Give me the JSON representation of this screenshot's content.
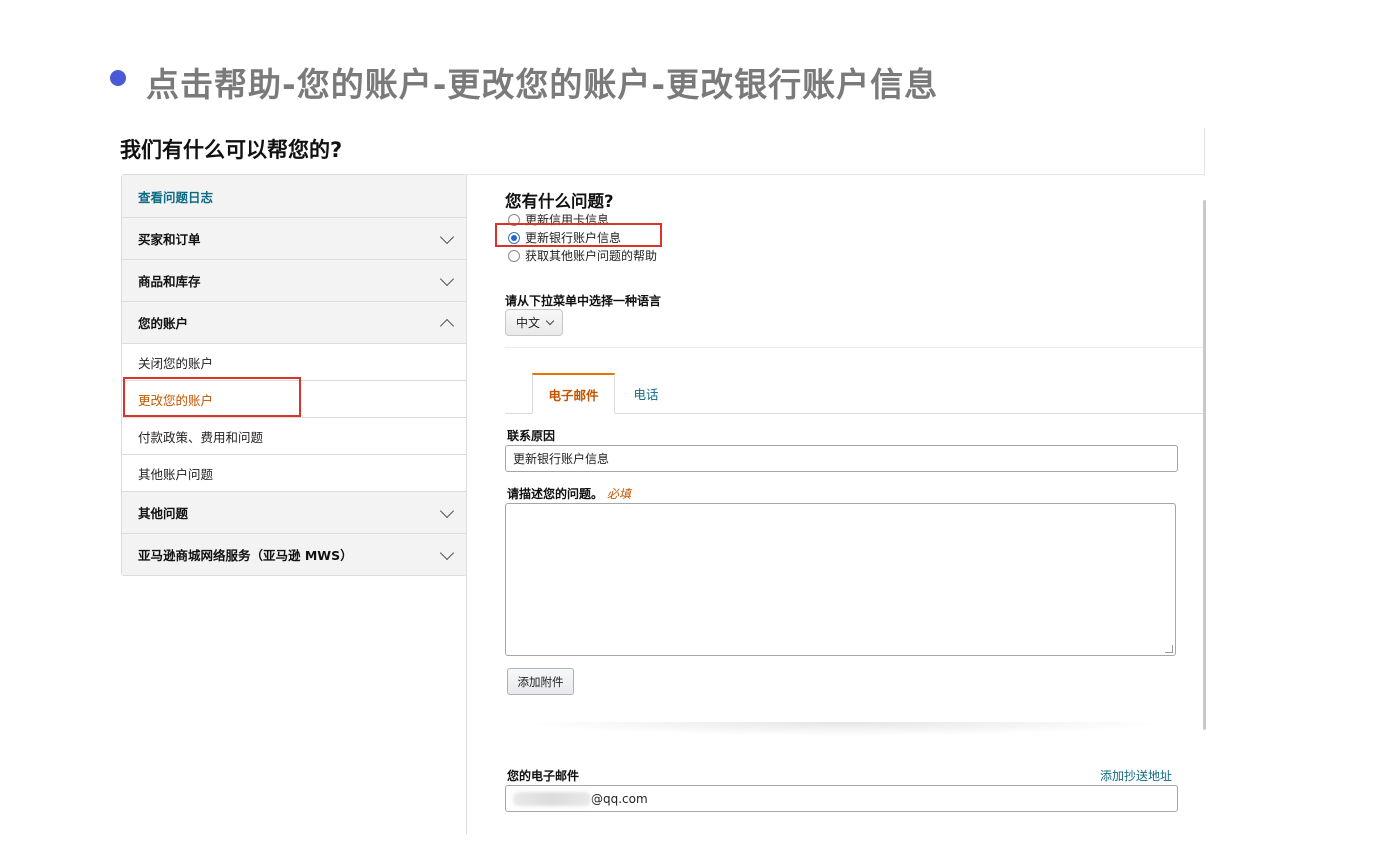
{
  "slide": {
    "title": "点击帮助-您的账户-更改您的账户-更改银行账户信息"
  },
  "page": {
    "heading": "我们有什么可以帮您的?"
  },
  "sidebar": {
    "items": [
      {
        "label": "查看问题日志"
      },
      {
        "label": "买家和订单"
      },
      {
        "label": "商品和库存"
      },
      {
        "label": "您的账户"
      },
      {
        "label": "关闭您的账户"
      },
      {
        "label": "更改您的账户"
      },
      {
        "label": "付款政策、费用和问题"
      },
      {
        "label": "其他账户问题"
      },
      {
        "label": "其他问题"
      },
      {
        "label": "亚马逊商城网络服务（亚马逊 MWS）"
      }
    ]
  },
  "form": {
    "question_title": "您有什么问题?",
    "options": [
      {
        "label": "更新信用卡信息",
        "selected": false
      },
      {
        "label": "更新银行账户信息",
        "selected": true
      },
      {
        "label": "获取其他账户问题的帮助",
        "selected": false
      }
    ],
    "language_label": "请从下拉菜单中选择一种语言",
    "language_value": "中文",
    "tabs": [
      {
        "label": "电子邮件",
        "active": true
      },
      {
        "label": "电话",
        "active": false
      }
    ],
    "reason_label": "联系原因",
    "reason_value": "更新银行账户信息",
    "describe_label": "请描述您的问题。",
    "required_text": "必填",
    "attach_button": "添加附件",
    "email_label": "您的电子邮件",
    "cc_link": "添加抄送地址",
    "email_value_suffix": "@qq.com"
  },
  "colors": {
    "accent_orange": "#c45500",
    "link_teal": "#0f6b84",
    "highlight_red": "#d9342b",
    "bullet_blue": "#4a5ad6"
  }
}
